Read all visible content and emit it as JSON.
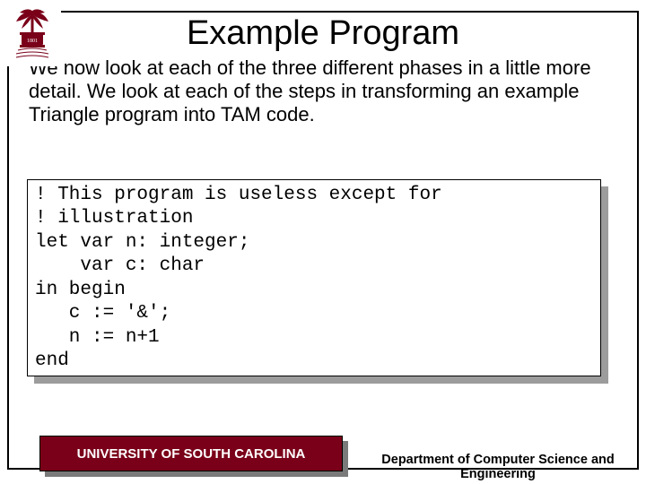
{
  "title": "Example Program",
  "paragraph": "We now look at each of the three different phases in a little more detail. We look at each of the steps in transforming an example Triangle program into TAM code.",
  "code": "! This program is useless except for\n! illustration\nlet var n: integer;\n    var c: char\nin begin\n   c := '&';\n   n := n+1\nend",
  "footer": {
    "university": "UNIVERSITY OF SOUTH CAROLINA",
    "department": "Department of Computer Science and Engineering"
  }
}
